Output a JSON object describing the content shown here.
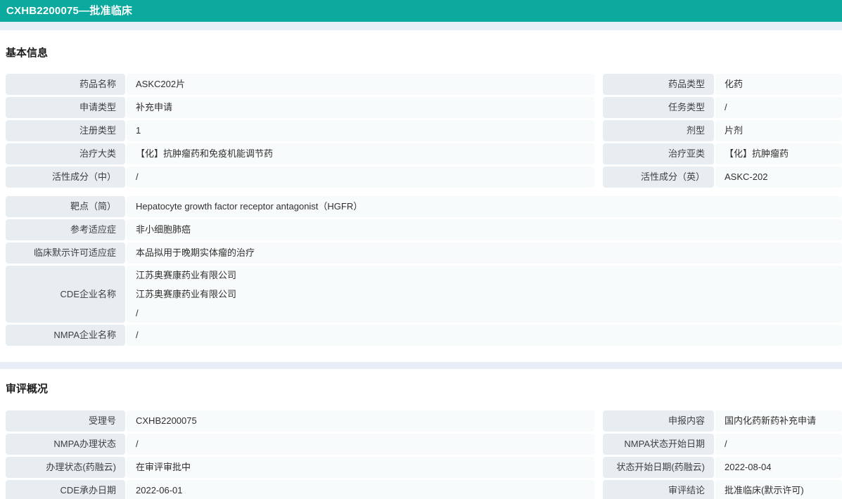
{
  "titlebar": {
    "title": "CXHB2200075—批准临床"
  },
  "colors": {
    "accent_teal": "#0ba99e",
    "divider_band": "#e9eff6",
    "label_cell_bg": "#e7edf0",
    "value_cell_bg": "#f7fbfb"
  },
  "sections": {
    "basic": {
      "heading": "基本信息",
      "left_rows": [
        {
          "label": "药品名称",
          "value": "ASKC202片"
        },
        {
          "label": "申请类型",
          "value": "补充申请"
        },
        {
          "label": "注册类型",
          "value": "1"
        },
        {
          "label": "治疗大类",
          "value": "【化】抗肿瘤药和免疫机能调节药"
        },
        {
          "label": "活性成分（中）",
          "value": "/"
        }
      ],
      "right_rows": [
        {
          "label": "药品类型",
          "value": "化药"
        },
        {
          "label": "任务类型",
          "value": "/"
        },
        {
          "label": "剂型",
          "value": "片剂"
        },
        {
          "label": "治疗亚类",
          "value": "【化】抗肿瘤药"
        },
        {
          "label": "活性成分（英）",
          "value": "ASKC-202"
        }
      ],
      "full_rows": [
        {
          "label": "靶点（简）",
          "value": "Hepatocyte growth factor receptor antagonist（HGFR）"
        },
        {
          "label": "参考适应症",
          "value": "非小细胞肺癌"
        },
        {
          "label": "临床默示许可适应症",
          "value": "本品拟用于晚期实体瘤的治疗"
        },
        {
          "label": "CDE企业名称",
          "lines": [
            "江苏奥赛康药业有限公司",
            "江苏奥赛康药业有限公司",
            "/"
          ]
        },
        {
          "label": "NMPA企业名称",
          "value": "/"
        }
      ]
    },
    "review": {
      "heading": "审评概况",
      "left_rows": [
        {
          "label": "受理号",
          "value": "CXHB2200075"
        },
        {
          "label": "NMPA办理状态",
          "value": "/"
        },
        {
          "label": "办理状态(药融云)",
          "value": "在审评审批中"
        },
        {
          "label": "CDE承办日期",
          "value": "2022-06-01"
        }
      ],
      "right_rows": [
        {
          "label": "申报内容",
          "value": "国内化药新药补充申请"
        },
        {
          "label": "NMPA状态开始日期",
          "value": "/"
        },
        {
          "label": "状态开始日期(药融云)",
          "value": "2022-08-04"
        },
        {
          "label": "审评结论",
          "value": "批准临床(默示许可)"
        }
      ]
    }
  }
}
